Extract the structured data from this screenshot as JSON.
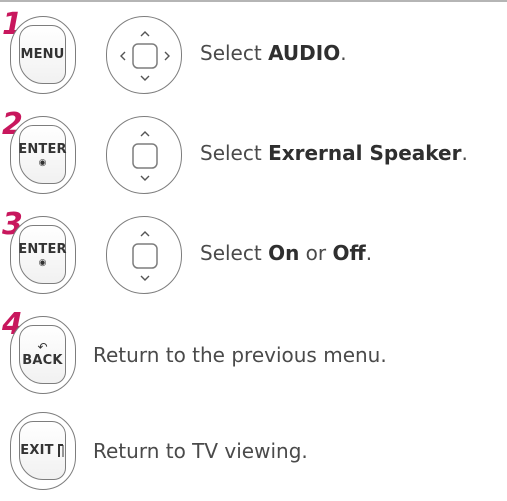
{
  "steps": [
    {
      "number": "1",
      "button": "MENU",
      "nav": "four-way",
      "text_prefix": "Select ",
      "text_bold": "AUDIO",
      "text_suffix": "."
    },
    {
      "number": "2",
      "button": "ENTER",
      "nav": "up-down",
      "text_prefix": "Select ",
      "text_bold": "Exrernal Speaker",
      "text_suffix": "."
    },
    {
      "number": "3",
      "button": "ENTER",
      "nav": "up-down",
      "text_prefix": "Select ",
      "text_bold": "On",
      "text_mid": " or ",
      "text_bold2": "Off",
      "text_suffix": "."
    },
    {
      "number": "4",
      "button": "BACK",
      "text": "Return to the previous menu."
    },
    {
      "button": "EXIT",
      "text": "Return to TV viewing."
    }
  ],
  "colors": {
    "step_number": "#c8175d",
    "text": "#4a4a4a",
    "outline": "#7d7d7d"
  }
}
